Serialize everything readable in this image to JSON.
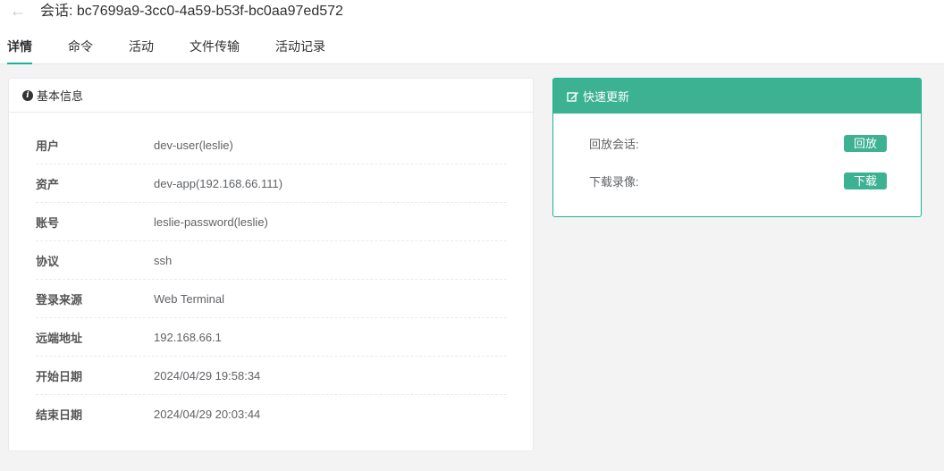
{
  "header": {
    "title": "会话: bc7699a9-3cc0-4a59-b53f-bc0aa97ed572",
    "back_icon": "arrow-left-icon"
  },
  "tabs": [
    {
      "label": "详情",
      "active": true
    },
    {
      "label": "命令",
      "active": false
    },
    {
      "label": "活动",
      "active": false
    },
    {
      "label": "文件传输",
      "active": false
    },
    {
      "label": "活动记录",
      "active": false
    }
  ],
  "basic_info": {
    "title": "基本信息",
    "icon": "info-circle-icon",
    "rows": [
      {
        "label": "用户",
        "value": "dev-user(leslie)"
      },
      {
        "label": "资产",
        "value": "dev-app(192.168.66.111)"
      },
      {
        "label": "账号",
        "value": "leslie-password(leslie)"
      },
      {
        "label": "协议",
        "value": "ssh"
      },
      {
        "label": "登录来源",
        "value": "Web Terminal"
      },
      {
        "label": "远端地址",
        "value": "192.168.66.1"
      },
      {
        "label": "开始日期",
        "value": "2024/04/29 19:58:34"
      },
      {
        "label": "结束日期",
        "value": "2024/04/29 20:03:44"
      }
    ]
  },
  "quick_update": {
    "title": "快速更新",
    "icon": "edit-icon",
    "accent_color": "#3cb292",
    "actions": [
      {
        "label": "回放会话:",
        "button": "回放"
      },
      {
        "label": "下载录像:",
        "button": "下载"
      }
    ]
  }
}
